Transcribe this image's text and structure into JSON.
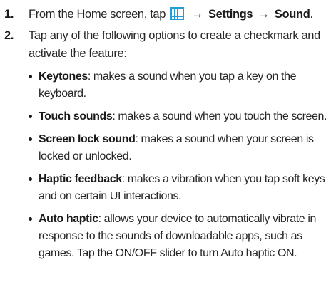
{
  "steps": [
    {
      "number": "1.",
      "prefix": "From the Home screen, tap",
      "icon": "apps-grid-icon",
      "icon_color": "#1f9ed8",
      "arrow1": "→",
      "menu1": "Settings",
      "arrow2": "→",
      "menu2": "Sound",
      "end": "."
    },
    {
      "number": "2.",
      "text": "Tap any of the following options to create a checkmark and activate the feature:",
      "bullets": [
        {
          "term": "Keytones",
          "desc": ": makes a sound when you tap a key on the keyboard."
        },
        {
          "term": "Touch sounds",
          "desc": ": makes a sound when you touch the screen."
        },
        {
          "term": "Screen lock sound",
          "desc": ": makes a sound when your screen is locked or unlocked."
        },
        {
          "term": "Haptic feedback",
          "desc": ": makes a vibration when you tap soft keys and on certain UI interactions."
        },
        {
          "term": "Auto haptic",
          "desc": ": allows your device to automatically vibrate in response to the sounds of downloadable apps, such as games. Tap the ON/OFF slider to turn Auto haptic ON."
        }
      ]
    }
  ]
}
